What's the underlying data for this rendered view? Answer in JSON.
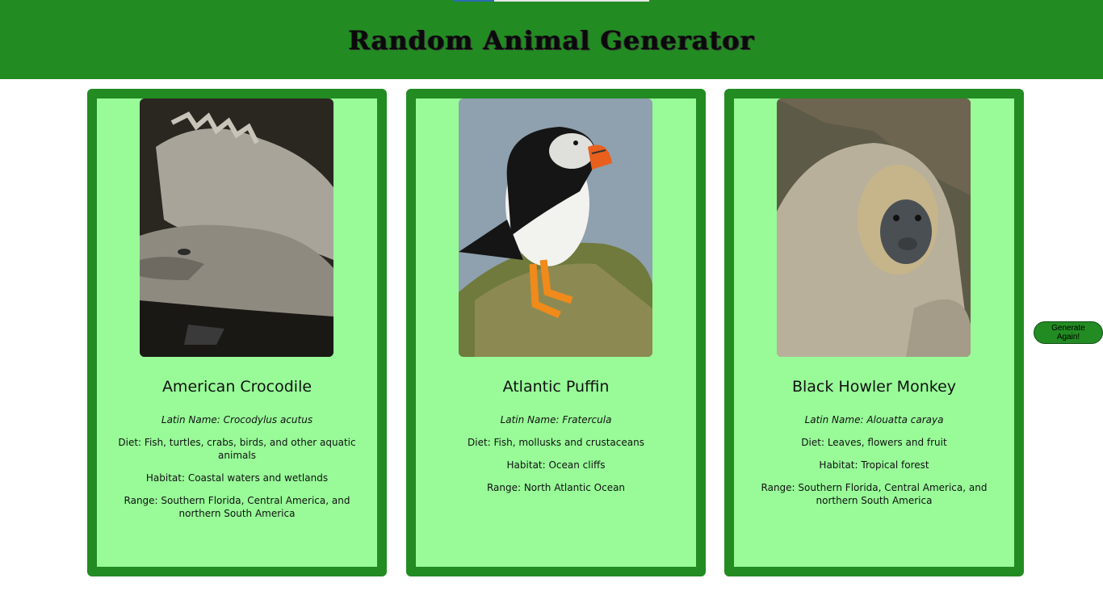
{
  "header": {
    "title": "Random Animal Generator"
  },
  "cards": [
    {
      "name": "American Crocodile",
      "latin": "Latin Name: Crocodylus acutus",
      "diet": "Diet: Fish, turtles, crabs, birds, and other aquatic animals",
      "habitat": "Habitat: Coastal waters and wetlands",
      "range": "Range: Southern Florida, Central America, and northern South America",
      "image_alt": "crocodile-photo"
    },
    {
      "name": "Atlantic Puffin",
      "latin": "Latin Name: Fratercula",
      "diet": "Diet: Fish, mollusks and crustaceans",
      "habitat": "Habitat: Ocean cliffs",
      "range": "Range: North Atlantic Ocean",
      "image_alt": "puffin-photo"
    },
    {
      "name": "Black Howler Monkey",
      "latin": "Latin Name: Alouatta caraya",
      "diet": "Diet: Leaves, flowers and fruit",
      "habitat": "Habitat: Tropical forest",
      "range": "Range: Southern Florida, Central America, and northern South America",
      "image_alt": "monkey-photo"
    }
  ],
  "generate_button": {
    "label": "Generate Again!"
  },
  "colors": {
    "header_bg": "#228b22",
    "card_bg": "#98fb98",
    "card_border": "#228b22"
  }
}
